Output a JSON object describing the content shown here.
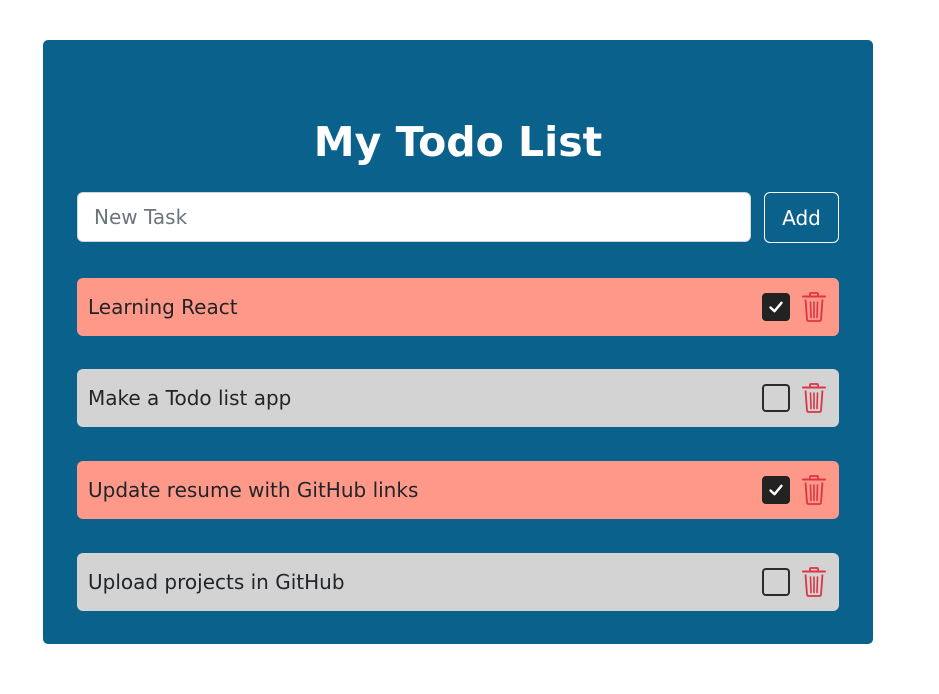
{
  "app": {
    "title": "My Todo List"
  },
  "new_task": {
    "placeholder": "New Task",
    "value": "",
    "add_label": "Add"
  },
  "tasks": [
    {
      "text": "Learning React",
      "completed": true
    },
    {
      "text": "Make a Todo list app",
      "completed": false
    },
    {
      "text": "Update resume with GitHub links",
      "completed": true
    },
    {
      "text": "Upload projects in GitHub",
      "completed": false
    }
  ],
  "icons": {
    "complete": "checkbox-icon",
    "delete": "trash-icon"
  },
  "colors": {
    "card_background": "#0a628c",
    "completed_task": "#fe9989",
    "pending_task": "#d3d3d3",
    "delete_icon": "#dc3545",
    "checkbox_checked": "#222222"
  }
}
